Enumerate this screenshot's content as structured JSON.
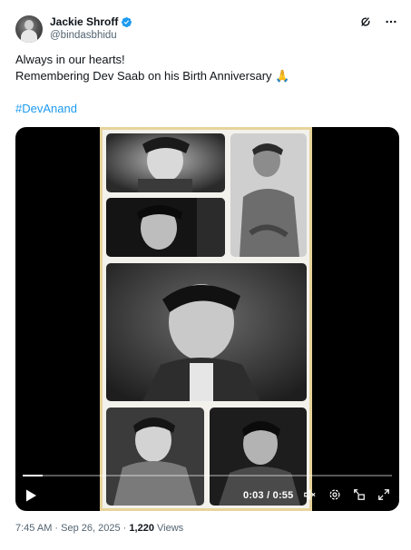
{
  "author": {
    "display_name": "Jackie Shroff",
    "handle": "@bindasbhidu",
    "verified_color": "#1d9bf0"
  },
  "tweet": {
    "line1": "Always in our hearts!",
    "line2": "Remembering Dev Saab on his Birth Anniversary",
    "emoji": "🙏",
    "hashtag": "#DevAnand"
  },
  "video": {
    "current_time": "0:03",
    "separator": "/",
    "duration": "0:55",
    "progress_fraction": 0.055,
    "controls": [
      "play-icon",
      "mute-icon",
      "settings-icon",
      "pip-icon",
      "fullscreen-icon"
    ]
  },
  "footer": {
    "time": "7:45 AM",
    "dot1": "·",
    "date": "Sep 26, 2025",
    "dot2": "·",
    "views_count": "1,220",
    "views_label": "Views"
  },
  "colors": {
    "text": "#0f1419",
    "secondary": "#536471",
    "accent": "#1d9bf0",
    "frame": "#e7d39a"
  }
}
